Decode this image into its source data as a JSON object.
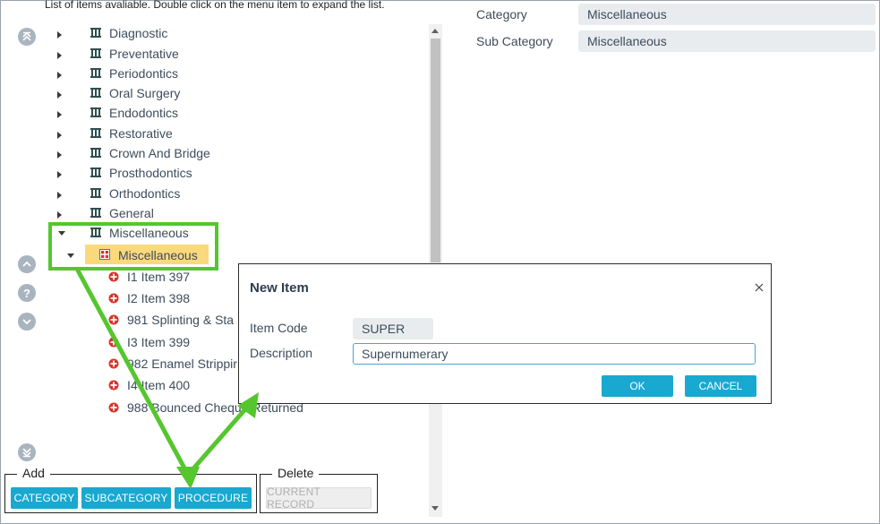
{
  "hint": "List of items avaliable. Double click on the menu item to expand the list.",
  "tree": {
    "categories": [
      {
        "label": "Diagnostic"
      },
      {
        "label": "Preventative"
      },
      {
        "label": "Periodontics"
      },
      {
        "label": "Oral Surgery"
      },
      {
        "label": "Endodontics"
      },
      {
        "label": "Restorative"
      },
      {
        "label": "Crown And Bridge"
      },
      {
        "label": "Prosthodontics"
      },
      {
        "label": "Orthodontics"
      },
      {
        "label": "General"
      },
      {
        "label": "Miscellaneous"
      }
    ],
    "subcategory": "Miscellaneous",
    "items": [
      {
        "label": "I1 Item 397"
      },
      {
        "label": "I2 Item 398"
      },
      {
        "label": "981 Splinting & Sta"
      },
      {
        "label": "I3 Item 399"
      },
      {
        "label": "982 Enamel Strippir"
      },
      {
        "label": "I4 Item 400"
      },
      {
        "label": "988 Bounced Cheque Returned"
      }
    ]
  },
  "details": {
    "category_label": "Category",
    "category_value": "Miscellaneous",
    "subcategory_label": "Sub Category",
    "subcategory_value": "Miscellaneous"
  },
  "add_group": {
    "title": "Add",
    "category_button": "CATEGORY",
    "subcategory_button": "SUBCATEGORY",
    "procedure_button": "PROCEDURE"
  },
  "delete_group": {
    "title": "Delete",
    "current_record_button": "CURRENT RECORD"
  },
  "dialog": {
    "title": "New Item",
    "item_code_label": "Item Code",
    "item_code_value": "SUPER",
    "description_label": "Description",
    "description_value": "Supernumerary",
    "ok_button": "OK",
    "cancel_button": "CANCEL"
  },
  "colors": {
    "accent": "#19a8cf",
    "highlight": "#f9d97b",
    "annotation": "#55c62e",
    "item_icon_red": "#d9342b"
  },
  "icons": {
    "category": "building-icon",
    "subcategory": "grid-icon",
    "item": "red-cross-icon",
    "nav_top": "double-chevron-up-icon",
    "nav_up": "chevron-up-icon",
    "nav_help": "question-icon",
    "nav_down": "chevron-down-icon",
    "nav_bottom": "double-chevron-down-icon"
  }
}
